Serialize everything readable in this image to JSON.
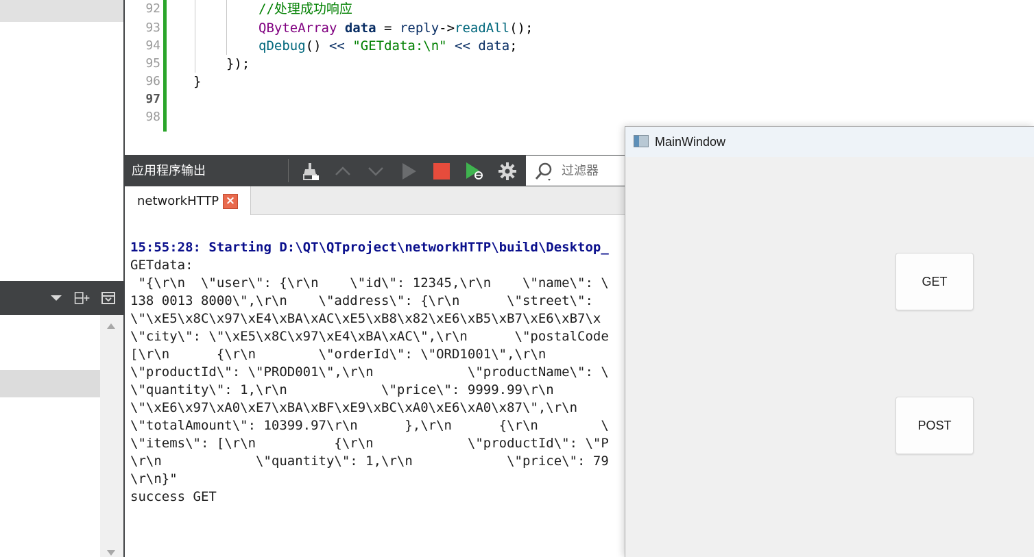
{
  "editor": {
    "lines": [
      {
        "num": "92",
        "current": false
      },
      {
        "num": "93",
        "current": false
      },
      {
        "num": "94",
        "current": false
      },
      {
        "num": "95",
        "current": false
      },
      {
        "num": "96",
        "current": false
      },
      {
        "num": "97",
        "current": true
      },
      {
        "num": "98",
        "current": false
      }
    ],
    "code": {
      "l92_comment": "//处理成功响应",
      "l93_type": "QByteArray",
      "l93_var": "data",
      "l93_eq": " = ",
      "l93_obj": "reply",
      "l93_arrow": "->",
      "l93_func": "readAll",
      "l93_end": "();",
      "l94_func": "qDebug",
      "l94_paren": "() ",
      "l94_op1": "<<",
      "l94_str": "\"GETdata:\\n\"",
      "l94_op2": "<<",
      "l94_var": "data",
      "l94_end": ";",
      "l95": "});",
      "l96": "}"
    }
  },
  "output_pane": {
    "title": "应用程序输出",
    "filter_placeholder": "过滤器",
    "tab_label": "networkHTTP",
    "tab_close": "×",
    "lines": [
      {
        "text": "15:55:28: Starting D:\\QT\\QTproject\\networkHTTP\\build\\Desktop_",
        "start": true
      },
      {
        "text": "GETdata:",
        "start": false
      },
      {
        "text": " \"{\\r\\n  \\\"user\\\": {\\r\\n    \\\"id\\\": 12345,\\r\\n    \\\"name\\\": \\",
        "start": false
      },
      {
        "text": "138 0013 8000\\\",\\r\\n    \\\"address\\\": {\\r\\n      \\\"street\\\":  ",
        "start": false
      },
      {
        "text": "\\\"\\xE5\\x8C\\x97\\xE4\\xBA\\xAC\\xE5\\xB8\\x82\\xE6\\xB5\\xB7\\xE6\\xB7\\x",
        "start": false
      },
      {
        "text": "\\\"city\\\": \\\"\\xE5\\x8C\\x97\\xE4\\xBA\\xAC\\\",\\r\\n      \\\"postalCode",
        "start": false
      },
      {
        "text": "[\\r\\n      {\\r\\n        \\\"orderId\\\": \\\"ORD1001\\\",\\r\\n",
        "start": false
      },
      {
        "text": "\\\"productId\\\": \\\"PROD001\\\",\\r\\n            \\\"productName\\\": \\",
        "start": false
      },
      {
        "text": "\\\"quantity\\\": 1,\\r\\n            \\\"price\\\": 9999.99\\r\\n",
        "start": false
      },
      {
        "text": "\\\"\\xE6\\x97\\xA0\\xE7\\xBA\\xBF\\xE9\\xBC\\xA0\\xE6\\xA0\\x87\\\",\\r\\n",
        "start": false
      },
      {
        "text": "\\\"totalAmount\\\": 10399.97\\r\\n      },\\r\\n      {\\r\\n        \\",
        "start": false
      },
      {
        "text": "\\\"items\\\": [\\r\\n          {\\r\\n            \\\"productId\\\": \\\"P",
        "start": false
      },
      {
        "text": "\\r\\n            \\\"quantity\\\": 1,\\r\\n            \\\"price\\\": 79",
        "start": false
      },
      {
        "text": "\\r\\n}\"",
        "start": false
      },
      {
        "text": "success GET",
        "start": false
      }
    ]
  },
  "main_window": {
    "title": "MainWindow",
    "buttons": {
      "get": "GET",
      "post": "POST"
    }
  },
  "colors": {
    "toolbar_bg": "#404244",
    "gutter_change": "#2aa52a",
    "stop_button": "#e74c3c",
    "start_line": "#0a0f8c"
  }
}
